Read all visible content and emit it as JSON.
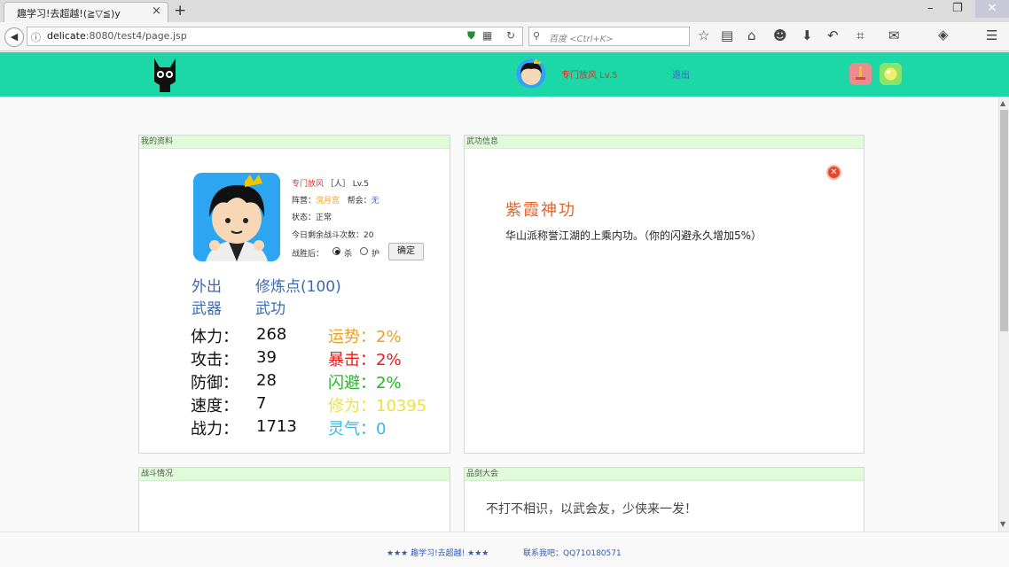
{
  "browser": {
    "tab_title": "趣学习!去超越!(≧▽≦)y",
    "tab_close": "×",
    "new_tab": "+",
    "window_controls": {
      "minimize": "–",
      "restore": "❐",
      "close": "✕"
    },
    "url_host": "delicate",
    "url_rest": ":8080/test4/page.jsp",
    "search_placeholder": "百度 <Ctrl+K>",
    "toolbar_icons": [
      "star-icon",
      "reading-list-icon",
      "home-icon",
      "chat-icon",
      "download-icon",
      "undo-icon",
      "crop-icon",
      "message-icon",
      "extension-icon",
      "menu-icon"
    ]
  },
  "header": {
    "username": "专门放风 Lv.5",
    "logout": "退出",
    "bg_color": "#1bd8a6"
  },
  "profile_panel": {
    "title": "我的资料",
    "name": "专门放风",
    "race": "［人］",
    "level": "Lv.5",
    "camp_label": "阵营：",
    "camp_value": "浣月宫",
    "guild_label": "帮会：",
    "guild_value": "无",
    "status_label": "状态：",
    "status_value": "正常",
    "battles_left": "今日剩余战斗次数：20",
    "after_win_label": "战胜后：",
    "opt_kill": "杀",
    "opt_protect": "护",
    "confirm": "确定",
    "link_out": "外出",
    "link_points": "修炼点(100)",
    "link_weapon": "武器",
    "link_skill": "武功",
    "stats": [
      {
        "label": "体力：",
        "value": "268"
      },
      {
        "label": "攻击：",
        "value": "39"
      },
      {
        "label": "防御：",
        "value": "28"
      },
      {
        "label": "速度：",
        "value": "7"
      },
      {
        "label": "战力：",
        "value": "1713"
      }
    ],
    "substats": [
      {
        "label": "运势：",
        "value": "2%",
        "color": "#f0a020"
      },
      {
        "label": "暴击：",
        "value": "2%",
        "color": "#f01818"
      },
      {
        "label": "闪避：",
        "value": "2%",
        "color": "#20b820"
      },
      {
        "label": "修为：",
        "value": "10395",
        "color": "#f0e040"
      },
      {
        "label": "灵气：",
        "value": "0",
        "color": "#38b8e8"
      }
    ]
  },
  "skill_panel": {
    "title": "武功信息",
    "close": "✕",
    "skill_name": "紫霞神功",
    "skill_desc": "华山派称誉江湖的上乘内功。（你的闪避永久增加5%）"
  },
  "battle_panel": {
    "title": "战斗情况"
  },
  "sword_panel": {
    "title": "品剑大会",
    "motto": "不打不相识，以武会友，少侠来一发！"
  },
  "footer": {
    "slogan": "★★★ 趣学习!去超越! ★★★",
    "contact": "联系我吧：QQ710180571"
  }
}
